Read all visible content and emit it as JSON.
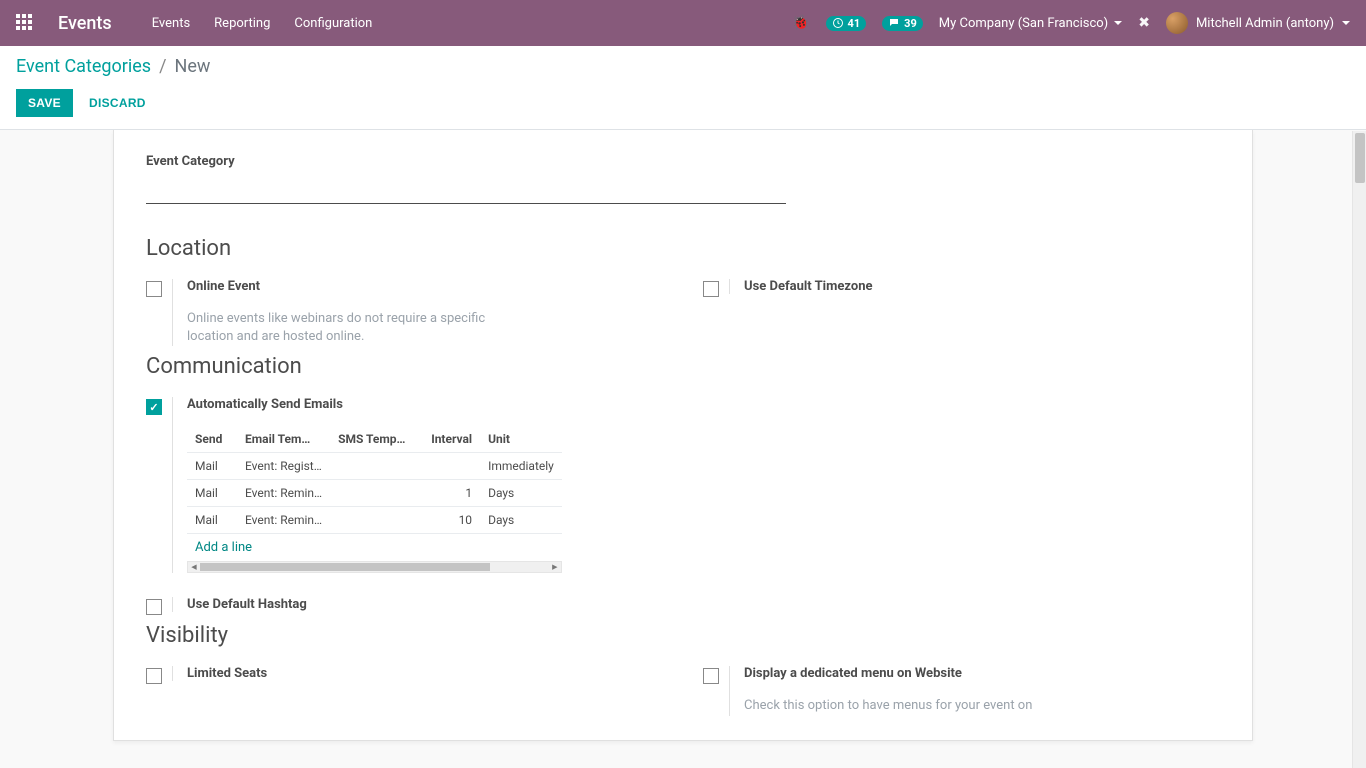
{
  "topnav": {
    "brand": "Events",
    "menus": [
      "Events",
      "Reporting",
      "Configuration"
    ],
    "badge1": "41",
    "badge2": "39",
    "company": "My Company (San Francisco)",
    "user": "Mitchell Admin (antony)"
  },
  "breadcrumb": {
    "root": "Event Categories",
    "sep": "/",
    "current": "New"
  },
  "buttons": {
    "save": "SAVE",
    "discard": "DISCARD"
  },
  "form": {
    "category_label": "Event Category",
    "sections": {
      "location": "Location",
      "communication": "Communication",
      "visibility": "Visibility"
    },
    "fields": {
      "online_event": "Online Event",
      "online_event_desc": "Online events like webinars do not require a specific location and are hosted online.",
      "use_default_timezone": "Use Default Timezone",
      "auto_send_emails": "Automatically Send Emails",
      "use_default_hashtag": "Use Default Hashtag",
      "limited_seats": "Limited Seats",
      "dedicated_menu": "Display a dedicated menu on Website",
      "dedicated_menu_desc": "Check this option to have menus for your event on"
    },
    "email_table": {
      "headers": {
        "send": "Send",
        "email_tmpl": "Email Tem…",
        "sms_tmpl": "SMS Temp…",
        "interval": "Interval",
        "unit": "Unit"
      },
      "rows": [
        {
          "send": "Mail",
          "email_tmpl": "Event: Regist…",
          "sms_tmpl": "",
          "interval": "",
          "unit": "Immediately"
        },
        {
          "send": "Mail",
          "email_tmpl": "Event: Remin…",
          "sms_tmpl": "",
          "interval": "1",
          "unit": "Days"
        },
        {
          "send": "Mail",
          "email_tmpl": "Event: Remin…",
          "sms_tmpl": "",
          "interval": "10",
          "unit": "Days"
        }
      ],
      "add_line": "Add a line"
    }
  }
}
